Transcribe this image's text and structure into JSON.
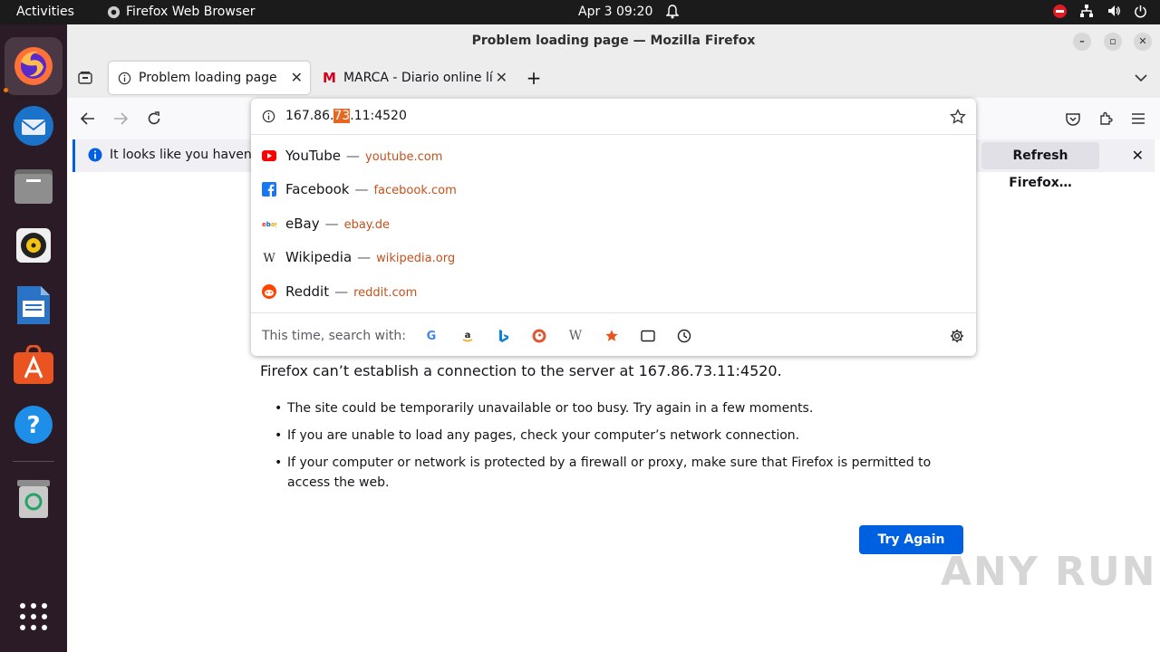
{
  "topbar": {
    "activities": "Activities",
    "app_name": "Firefox Web Browser",
    "clock": "Apr 3  09:20"
  },
  "dock": {
    "items": [
      {
        "name": "firefox",
        "active": true
      },
      {
        "name": "thunderbird"
      },
      {
        "name": "files"
      },
      {
        "name": "rhythmbox"
      },
      {
        "name": "libreoffice-writer"
      },
      {
        "name": "app-center"
      },
      {
        "name": "help"
      },
      {
        "name": "trash"
      }
    ]
  },
  "window": {
    "title": "Problem loading page — Mozilla Firefox"
  },
  "tabs": [
    {
      "label": "Problem loading page",
      "selected": true
    },
    {
      "label": "MARCA - Diario online líd",
      "selected": false
    }
  ],
  "urlbar": {
    "value_pre": "167.86.",
    "value_sel": "73",
    "value_post": ".11:4520"
  },
  "suggestions": [
    {
      "name": "YouTube",
      "url": "youtube.com",
      "icon": "youtube-icon"
    },
    {
      "name": "Facebook",
      "url": "facebook.com",
      "icon": "facebook-icon"
    },
    {
      "name": "eBay",
      "url": "ebay.de",
      "icon": "ebay-icon"
    },
    {
      "name": "Wikipedia",
      "url": "wikipedia.org",
      "icon": "wikipedia-icon"
    },
    {
      "name": "Reddit",
      "url": "reddit.com",
      "icon": "reddit-icon"
    }
  ],
  "dash": "—",
  "search_with": {
    "label": "This time, search with:",
    "engines": [
      "google",
      "amazon",
      "bing",
      "duckduckgo",
      "wikipedia",
      "bookmarks",
      "tabs",
      "history"
    ]
  },
  "infobar": {
    "message": "It looks like you haven’t",
    "button": "Refresh Firefox…"
  },
  "error": {
    "main": "Firefox can’t establish a connection to the server at 167.86.73.11:4520.",
    "items": [
      "The site could be temporarily unavailable or too busy. Try again in a few moments.",
      "If you are unable to load any pages, check your computer’s network connection.",
      "If your computer or network is protected by a firewall or proxy, make sure that Firefox is permitted to access the web."
    ],
    "button": "Try Again"
  },
  "watermark": "ANY RUN",
  "colors": {
    "accent": "#0061e0",
    "url_highlight": "#e66722",
    "suggestion_url": "#c4511c"
  }
}
